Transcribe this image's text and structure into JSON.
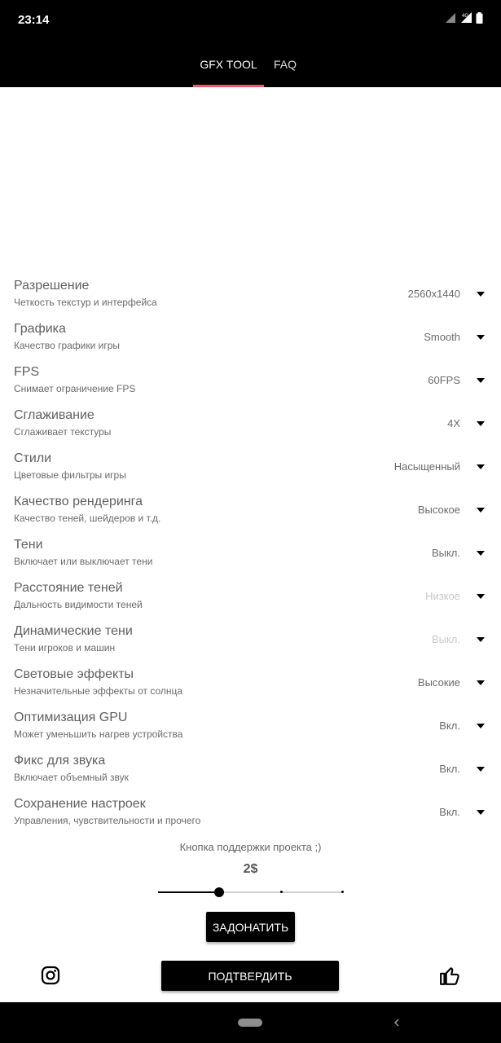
{
  "status_bar": {
    "time": "23:14",
    "network": "4G"
  },
  "tabs": [
    {
      "label": "GFX TOOL",
      "active": true
    },
    {
      "label": "FAQ",
      "active": false
    }
  ],
  "accent_color": "#ee5b66",
  "settings": [
    {
      "title": "Разрешение",
      "subtitle": "Четкость текстур и интерфейса",
      "value": "2560x1440",
      "enabled": true
    },
    {
      "title": "Графика",
      "subtitle": "Качество графики игры",
      "value": "Smooth",
      "enabled": true
    },
    {
      "title": "FPS",
      "subtitle": "Снимает ограничение FPS",
      "value": "60FPS",
      "enabled": true
    },
    {
      "title": "Сглаживание",
      "subtitle": "Сглаживает текстуры",
      "value": "4X",
      "enabled": true
    },
    {
      "title": "Стили",
      "subtitle": "Цветовые фильтры игры",
      "value": "Насыщенный",
      "enabled": true
    },
    {
      "title": "Качество рендеринга",
      "subtitle": "Качество теней, шейдеров и т.д.",
      "value": "Высокое",
      "enabled": true
    },
    {
      "title": "Тени",
      "subtitle": "Включает или выключает тени",
      "value": "Выкл.",
      "enabled": true
    },
    {
      "title": "Расстояние теней",
      "subtitle": "Дальность видимости теней",
      "value": "Низкое",
      "enabled": false
    },
    {
      "title": "Динамические тени",
      "subtitle": "Тени игроков и машин",
      "value": "Выкл.",
      "enabled": false
    },
    {
      "title": "Световые эффекты",
      "subtitle": "Незначительные эффекты от солнца",
      "value": "Высокие",
      "enabled": true
    },
    {
      "title": "Оптимизация GPU",
      "subtitle": "Может уменьшить нагрев устройства",
      "value": "Вкл.",
      "enabled": true
    },
    {
      "title": "Фикс для звука",
      "subtitle": "Включает объемный звук",
      "value": "Вкл.",
      "enabled": true
    },
    {
      "title": "Сохранение настроек",
      "subtitle": "Управления, чувствительности и прочего",
      "value": "Вкл.",
      "enabled": true
    }
  ],
  "support": {
    "label": "Кнопка поддержки проекта ;)",
    "amount": "2$",
    "slider_fraction": 0.333,
    "slider_steps": 3
  },
  "buttons": {
    "donate": "ЗАДОНАТИТЬ",
    "confirm": "ПОДТВЕРДИТЬ"
  },
  "icons": {
    "left": "instagram-icon",
    "right": "thumbs-up-icon"
  }
}
